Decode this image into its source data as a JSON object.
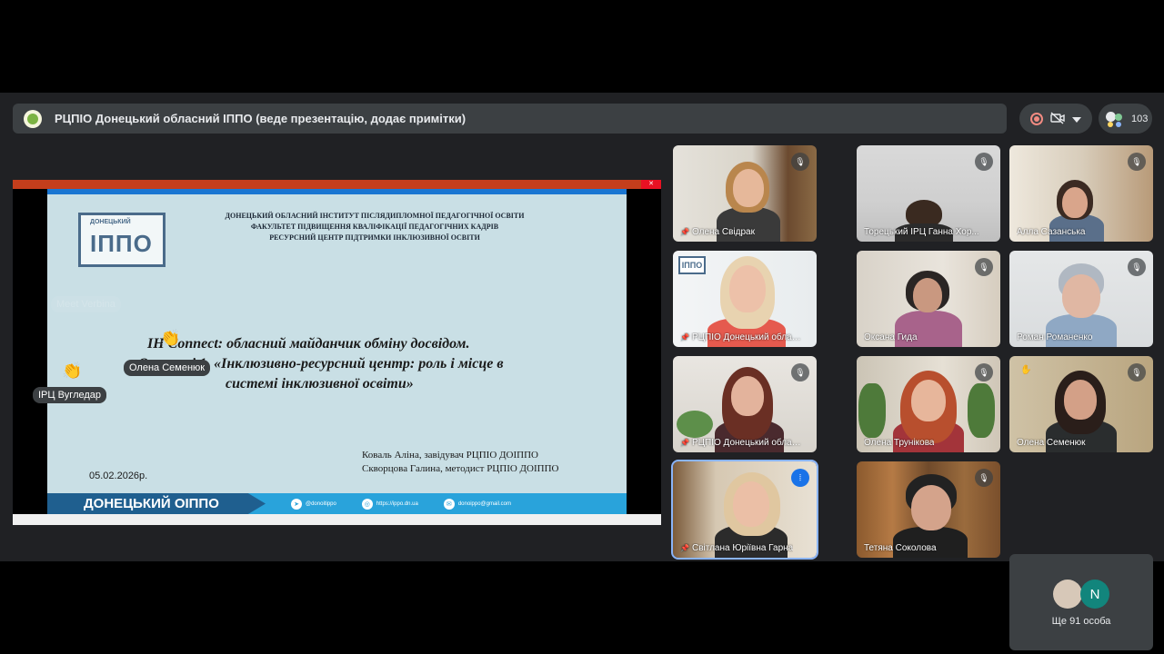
{
  "topbar": {
    "title": "РЦПІО Донецький обласний ІППО (веде презентацію, додає примітки)"
  },
  "controls": {
    "record_icon": "record-icon",
    "camera_off_icon": "camera-off-icon",
    "menu_icon": "chevron-down-icon",
    "participant_count": "103"
  },
  "slide": {
    "logo_small": "ДОНЕЦЬКИЙ",
    "logo_big": "ІППО",
    "header_lines": [
      "ДОНЕЦЬКИЙ ОБЛАСНИЙ ІНСТИТУТ ПІСЛЯДИПЛОМНОЇ ПЕДАГОГІЧНОЇ ОСВІТИ",
      "ФАКУЛЬТЕТ ПІДВИЩЕННЯ КВАЛІФІКАЦІЇ ПЕДАГОГІЧНИХ КАДРІВ",
      "РЕСУРСНИЙ ЦЕНТР ПІДТРИМКИ ІНКЛЮЗИВНОЇ ОСВІТИ"
    ],
    "main_lines": [
      "ІН Connect: обласний майданчик обміну досвідом.",
      "Ос          і 1. «Інклюзивно-ресурсний центр: роль і місце в",
      "системі інклюзивної освіти»"
    ],
    "authors": [
      "Коваль Аліна, завідувач РЦПІО ДОІППО",
      "Скворцова Галина, методист  РЦПІО ДОІППО"
    ],
    "date": "05.02.2026р.",
    "footer_brand": "ДОНЕЦЬКИЙ ОІППО",
    "footer_items": [
      "@donoitippo",
      "https://ippo.dn.ua",
      "donoippo@gmail.com"
    ]
  },
  "reactions": {
    "ghost": "Meet Verbina",
    "olena": "Олена Семенюк",
    "irc": "ІРЦ Вугледар",
    "emoji": "👏"
  },
  "tiles": [
    {
      "name": "Олена Свідрак",
      "pinned": true
    },
    {
      "name": "Торецький ІРЦ Ганна Хор..."
    },
    {
      "name": "Алла Сазанська"
    },
    {
      "name": "РЦПІО Донецький обласни...",
      "pinned": true
    },
    {
      "name": "Оксана Гида"
    },
    {
      "name": "Роман Романенко"
    },
    {
      "name": "РЦПІО Донецький обласн...",
      "pinned": true
    },
    {
      "name": "Олена Трунікова"
    },
    {
      "name": "Олена Семенюк"
    },
    {
      "name": "Світлана Юріївна Гарна",
      "pinned": true
    },
    {
      "name": "Тетяна Соколова"
    }
  ],
  "more": {
    "initial": "N",
    "label": "Ще 91 особа"
  }
}
